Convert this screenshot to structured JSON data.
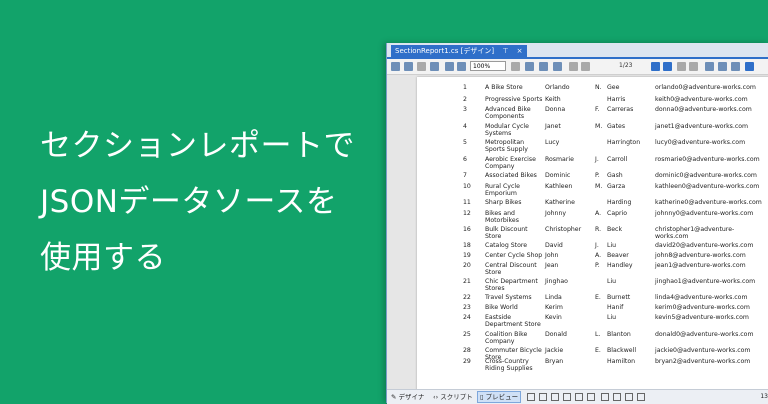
{
  "headline": {
    "line1": "セクションレポートで",
    "line2": "JSONデータソースを",
    "line3": "使用する"
  },
  "window": {
    "tab_title": "SectionReport1.cs [デザイン]",
    "tab_pin": "⊤",
    "tab_close": "×",
    "zoom": "100%",
    "page_counter": "1/23"
  },
  "report_rows": [
    {
      "num": "1",
      "store": "A Bike Store",
      "first": "Orlando",
      "mid": "N.",
      "last": "Gee",
      "mail": "orlando0@adventure-works.com"
    },
    {
      "num": "2",
      "store": "Progressive Sports",
      "first": "Keith",
      "mid": "",
      "last": "Harris",
      "mail": "keith0@adventure-works.com"
    },
    {
      "num": "3",
      "store": "Advanced Bike Components",
      "first": "Donna",
      "mid": "F.",
      "last": "Carreras",
      "mail": "donna0@adventure-works.com"
    },
    {
      "num": "4",
      "store": "Modular Cycle Systems",
      "first": "Janet",
      "mid": "M.",
      "last": "Gates",
      "mail": "janet1@adventure-works.com"
    },
    {
      "num": "5",
      "store": "Metropolitan Sports Supply",
      "first": "Lucy",
      "mid": "",
      "last": "Harrington",
      "mail": "lucy0@adventure-works.com"
    },
    {
      "num": "6",
      "store": "Aerobic Exercise Company",
      "first": "Rosmarie",
      "mid": "J.",
      "last": "Carroll",
      "mail": "rosmarie0@adventure-works.com"
    },
    {
      "num": "7",
      "store": "Associated Bikes",
      "first": "Dominic",
      "mid": "P.",
      "last": "Gash",
      "mail": "dominic0@adventure-works.com"
    },
    {
      "num": "10",
      "store": "Rural Cycle Emporium",
      "first": "Kathleen",
      "mid": "M.",
      "last": "Garza",
      "mail": "kathleen0@adventure-works.com"
    },
    {
      "num": "11",
      "store": "Sharp Bikes",
      "first": "Katherine",
      "mid": "",
      "last": "Harding",
      "mail": "katherine0@adventure-works.com"
    },
    {
      "num": "12",
      "store": "Bikes and Motorbikes",
      "first": "Johnny",
      "mid": "A.",
      "last": "Caprio",
      "mail": "johnny0@adventure-works.com"
    },
    {
      "num": "16",
      "store": "Bulk Discount Store",
      "first": "Christopher",
      "mid": "R.",
      "last": "Beck",
      "mail": "christopher1@adventure-works.com"
    },
    {
      "num": "18",
      "store": "Catalog Store",
      "first": "David",
      "mid": "J.",
      "last": "Liu",
      "mail": "david20@adventure-works.com"
    },
    {
      "num": "19",
      "store": "Center Cycle Shop",
      "first": "John",
      "mid": "A.",
      "last": "Beaver",
      "mail": "john8@adventure-works.com"
    },
    {
      "num": "20",
      "store": "Central Discount Store",
      "first": "Jean",
      "mid": "P.",
      "last": "Handley",
      "mail": "jean1@adventure-works.com"
    },
    {
      "num": "21",
      "store": "Chic Department Stores",
      "first": "Jinghao",
      "mid": "",
      "last": "Liu",
      "mail": "jinghao1@adventure-works.com"
    },
    {
      "num": "22",
      "store": "Travel Systems",
      "first": "Linda",
      "mid": "E.",
      "last": "Burnett",
      "mail": "linda4@adventure-works.com"
    },
    {
      "num": "23",
      "store": "Bike World",
      "first": "Kerim",
      "mid": "",
      "last": "Hanif",
      "mail": "kerim0@adventure-works.com"
    },
    {
      "num": "24",
      "store": "Eastside Department Store",
      "first": "Kevin",
      "mid": "",
      "last": "Liu",
      "mail": "kevin5@adventure-works.com"
    },
    {
      "num": "25",
      "store": "Coalition Bike Company",
      "first": "Donald",
      "mid": "L.",
      "last": "Blanton",
      "mail": "donald0@adventure-works.com"
    },
    {
      "num": "28",
      "store": "Commuter Bicycle Store",
      "first": "Jackie",
      "mid": "E.",
      "last": "Blackwell",
      "mail": "jackie0@adventure-works.com"
    },
    {
      "num": "29",
      "store": "Cross-Country Riding Supplies",
      "first": "Bryan",
      "mid": "",
      "last": "Hamilton",
      "mail": "bryan2@adventure-works.com"
    }
  ],
  "statusbar": {
    "designer": "デザイナ",
    "script": "スクリプト",
    "preview": "プレビュー",
    "page_num": "13"
  },
  "colors": {
    "background": "#12a36a",
    "accent": "#2f6fc9"
  }
}
